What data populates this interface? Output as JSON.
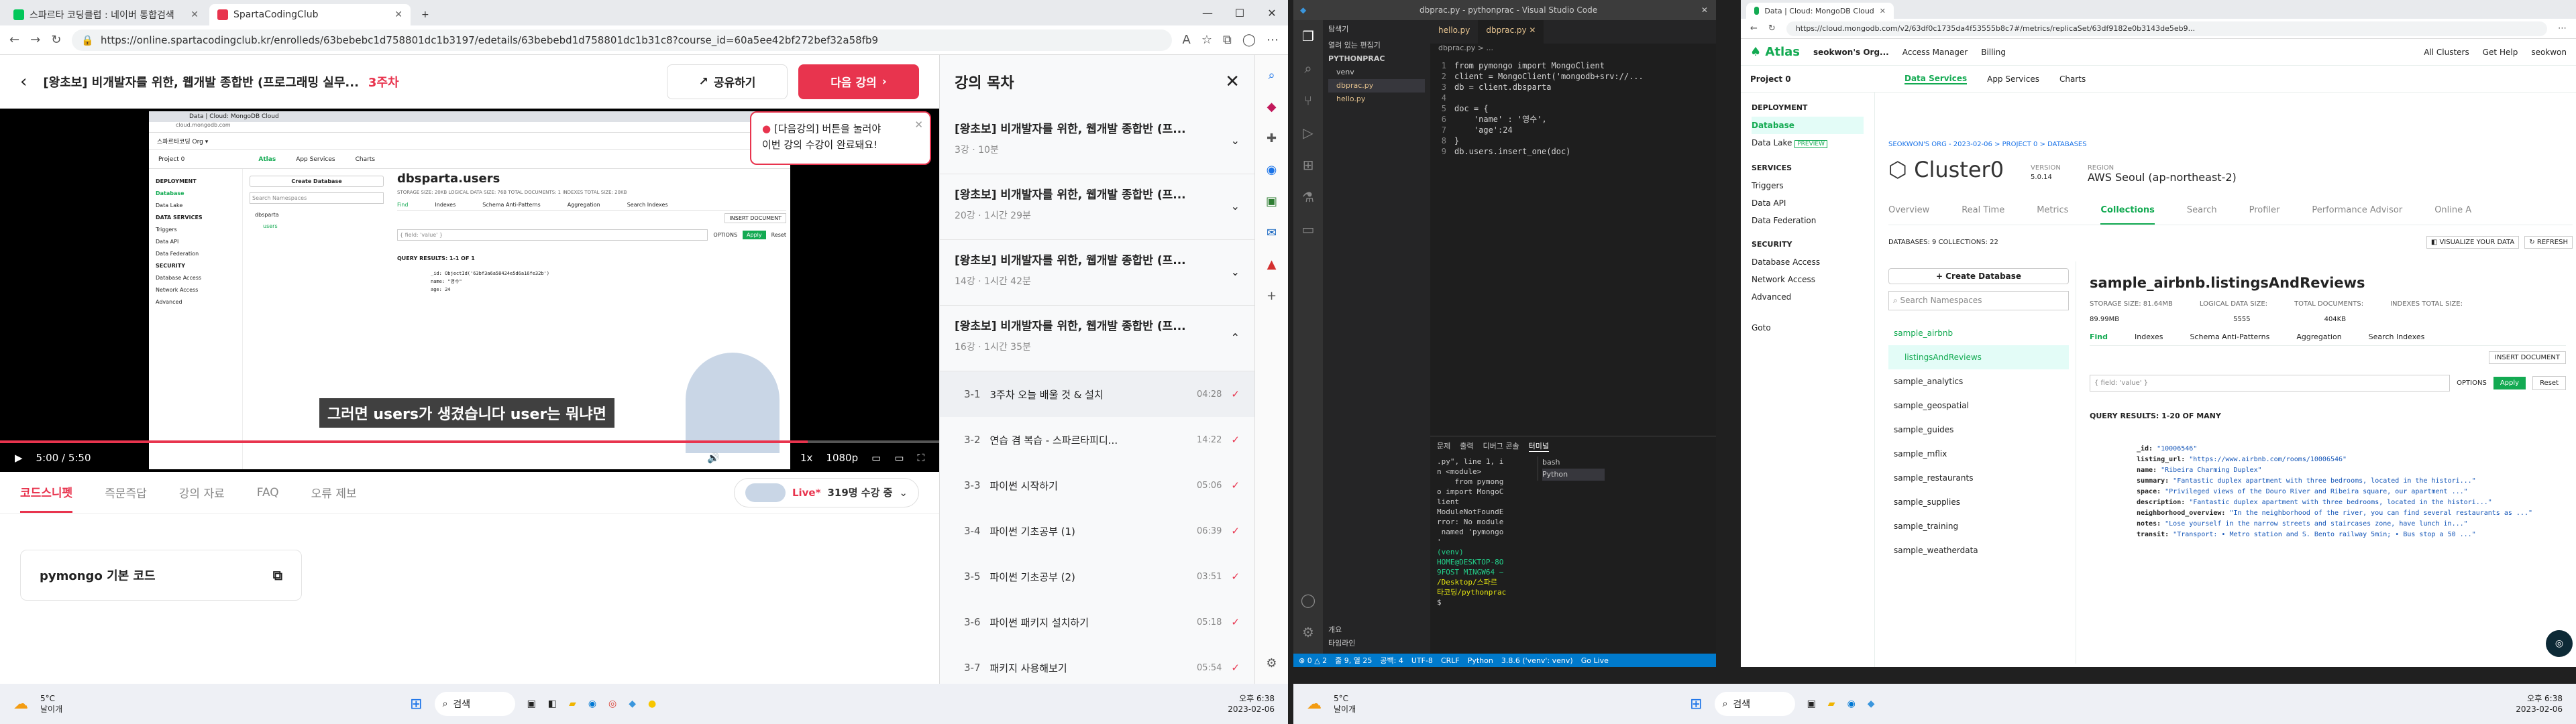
{
  "w1": {
    "tabs": [
      "스파르타 코딩클럽 : 네이버 통합검색",
      "SpartaCodingClub"
    ],
    "url": "https://online.spartacodingclub.kr/enrolleds/63bebebc1d758801dc1b3197/edetails/63bebebd1d758801dc1b31c8?course_id=60a5ee42bf272bef32a58fb9",
    "course_title": "[왕초보] 비개발자를 위한, 웹개발 종합반 (프로그래밍 실무...",
    "week": "3주차",
    "share": "공유하기",
    "next": "다음 강의",
    "tooltip1": "[다음강의] 버튼을 눌러야",
    "tooltip2": "이번 강의 수강이 완료돼요!",
    "subtitle": "그러면 users가 생겼습니다 user는 뭐냐면",
    "time": "5:00 / 5:50",
    "speed": "1x",
    "quality": "1080p",
    "tabs_below": [
      "코드스니펫",
      "즉문즉답",
      "강의 자료",
      "FAQ",
      "오류 제보"
    ],
    "live": "Live*",
    "live_count": "319명 수강 중",
    "snippet": "pymongo 기본 코드",
    "toc_title": "강의 목차",
    "weeks": [
      {
        "title": "[왕초보] 비개발자를 위한, 웹개발 종합반 (프...",
        "meta": "3강 · 10분"
      },
      {
        "title": "[왕초보] 비개발자를 위한, 웹개발 종합반 (프...",
        "meta": "20강 · 1시간 29분"
      },
      {
        "title": "[왕초보] 비개발자를 위한, 웹개발 종합반 (프...",
        "meta": "14강 · 1시간 42분"
      },
      {
        "title": "[왕초보] 비개발자를 위한, 웹개발 종합반 (프...",
        "meta": "16강 · 1시간 35분"
      }
    ],
    "lessons": [
      {
        "num": "3-1",
        "name": "3주차 오늘 배울 것 & 설치",
        "time": "04:28"
      },
      {
        "num": "3-2",
        "name": "연습 겸 복습 - 스파르타피디...",
        "time": "14:22"
      },
      {
        "num": "3-3",
        "name": "파이썬 시작하기",
        "time": "05:06"
      },
      {
        "num": "3-4",
        "name": "파이썬 기초공부 (1)",
        "time": "06:39"
      },
      {
        "num": "3-5",
        "name": "파이썬 기초공부 (2)",
        "time": "03:51"
      },
      {
        "num": "3-6",
        "name": "파이썬 패키지 설치하기",
        "time": "05:18"
      },
      {
        "num": "3-7",
        "name": "패키지 사용해보기",
        "time": "05:54"
      }
    ],
    "video": {
      "tab": "Data | Cloud: MongoDB Cloud",
      "crumbs": "스파르타코딩 Org ▾",
      "project": "Project 0",
      "coll": "dbsparta.users",
      "storage": "STORAGE SIZE: 20KB   LOGICAL DATA SIZE: 76B   TOTAL DOCUMENTS: 1   INDEXES TOTAL SIZE: 20KB",
      "ctabs": [
        "Find",
        "Indexes",
        "Schema Anti-Patterns",
        "Aggregation",
        "Search Indexes"
      ],
      "results": "QUERY RESULTS: 1-1 OF 1",
      "doc": [
        "_id: ObjectId('63bf3a6a58424e5d6a16fe32b')",
        "name: \"영수\"",
        "age: 24"
      ],
      "side": [
        "DEPLOYMENT",
        "Database",
        "Data Lake",
        "DATA SERVICES",
        "Triggers",
        "Data API",
        "Data Federation",
        "SECURITY",
        "Database Access",
        "Network Access",
        "Advanced"
      ],
      "nav": [
        "Atlas",
        "App Services",
        "Charts"
      ],
      "create": "Create Database",
      "search": "Search Namespaces",
      "db": "dbsparta",
      "col": "users",
      "insert": "INSERT DOCUMENT",
      "filter": "{ field: 'value' }",
      "opts": "OPTIONS",
      "apply": "Apply",
      "reset": "Reset"
    }
  },
  "w2": {
    "title": "dbprac.py - pythonprac - Visual Studio Code",
    "explorer": "탐색기",
    "open_editors": "열려 있는 편집기",
    "folder": "PYTHONPRAC",
    "files": [
      "venv",
      "dbprac.py",
      "hello.py"
    ],
    "tabs": [
      "hello.py",
      "dbprac.py"
    ],
    "crumb": "dbprac.py > ...",
    "code": [
      "from pymongo import MongoClient",
      "client = MongoClient('mongodb+srv://...",
      "db = client.dbsparta",
      "",
      "doc = {",
      "    'name' : '영수',",
      "    'age':24",
      "}",
      "db.users.insert_one(doc)"
    ],
    "panel_tabs": [
      "문제",
      "출력",
      "디버그 콘솔",
      "터미널"
    ],
    "terminal": [
      ".py\", line 1, i",
      "n <module>",
      "    from pymong",
      "o import MongoC",
      "lient",
      "ModuleNotFoundE",
      "rror: No module",
      " named 'pymongo",
      "'",
      "(venv)",
      "HOME@DESKTOP-8O",
      "9FOST MINGW64 ~",
      "/Desktop/스파르",
      "타코딩/pythonprac",
      "$"
    ],
    "shells": [
      "bash",
      "Python"
    ],
    "outline": [
      "개요",
      "타임라인"
    ],
    "status": [
      "⊗ 0 △ 2",
      "줄 9, 열 25",
      "공백: 4",
      "UTF-8",
      "CRLF",
      "Python",
      "3.8.6 ('venv': venv)",
      "Go Live"
    ]
  },
  "w3": {
    "tab": "Data | Cloud: MongoDB Cloud",
    "url": "https://cloud.mongodb.com/v2/63df0c1735da4f53555b8c7#/metrics/replicaSet/63df9182e0b3143de5eb9...",
    "org": "seokwon's Org...",
    "access": "Access Manager",
    "billing": "Billing",
    "clusters": "All Clusters",
    "help": "Get Help",
    "user": "seokwon",
    "project": "Project 0",
    "nav": [
      "Data Services",
      "App Services",
      "Charts"
    ],
    "side": {
      "deploy": "DEPLOYMENT",
      "database": "Database",
      "datalake": "Data Lake",
      "preview": "PREVIEW",
      "services": "SERVICES",
      "triggers": "Triggers",
      "dataapi": "Data API",
      "federation": "Data Federation",
      "security": "SECURITY",
      "dbaccess": "Database Access",
      "netaccess": "Network Access",
      "advanced": "Advanced",
      "goto": "Goto"
    },
    "crumbs": "SEOKWON'S ORG - 2023-02-06 > PROJECT 0 > DATABASES",
    "cluster": "Cluster0",
    "version_l": "VERSION",
    "version": "5.0.14",
    "region_l": "REGION",
    "region": "AWS Seoul (ap-northeast-2)",
    "ctabs": [
      "Overview",
      "Real Time",
      "Metrics",
      "Collections",
      "Search",
      "Profiler",
      "Performance Advisor",
      "Online A"
    ],
    "dbcount": "DATABASES: 9   COLLECTIONS: 22",
    "viz": "VISUALIZE YOUR DATA",
    "refresh": "REFRESH",
    "create": "Create Database",
    "search": "Search Namespaces",
    "dbs": [
      "sample_airbnb",
      "listingsAndReviews",
      "sample_analytics",
      "sample_geospatial",
      "sample_guides",
      "sample_mflix",
      "sample_restaurants",
      "sample_supplies",
      "sample_training",
      "sample_weatherdata"
    ],
    "coll": "sample_airbnb.listingsAndReviews",
    "stats_l": [
      "STORAGE SIZE: 81.64MB",
      "LOGICAL DATA SIZE:",
      "TOTAL DOCUMENTS:",
      "INDEXES TOTAL SIZE:"
    ],
    "stats": [
      "89.99MB",
      "5555",
      "404KB"
    ],
    "qtabs": [
      "Find",
      "Indexes",
      "Schema Anti-Patterns",
      "Aggregation",
      "Search Indexes"
    ],
    "insert": "INSERT DOCUMENT",
    "filter": "{ field: 'value' }",
    "opts": "OPTIONS",
    "apply": "Apply",
    "reset": "Reset",
    "results": "QUERY RESULTS: 1-20 OF MANY",
    "doc": [
      [
        "_id:",
        "\"10006546\""
      ],
      [
        "listing_url:",
        "\"https://www.airbnb.com/rooms/10006546\""
      ],
      [
        "name:",
        "\"Ribeira Charming Duplex\""
      ],
      [
        "summary:",
        "\"Fantastic duplex apartment with three bedrooms, located in the histori...\""
      ],
      [
        "space:",
        "\"Privileged views of the Douro River and Ribeira square, our apartment ...\""
      ],
      [
        "description:",
        "\"Fantastic duplex apartment with three bedrooms, located in the histori...\""
      ],
      [
        "neighborhood_overview:",
        "\"In the neighborhood of the river, you can find several restaurants as ...\""
      ],
      [
        "notes:",
        "\"Lose yourself in the narrow streets and staircases zone, have lunch in...\""
      ],
      [
        "transit:",
        "\"Transport: • Metro station and S. Bento railway 5min; • Bus stop a 50 ...\""
      ]
    ]
  },
  "taskbar": {
    "weather": "5°C",
    "weather_sub": "날이개",
    "search": "검색",
    "time": "오후 6:38",
    "date": "2023-02-06"
  },
  "taskbar2": {
    "weather": "5°C",
    "weather_sub": "날이개",
    "search": "검색",
    "time": "오후 6:38",
    "date": "2023-02-06"
  }
}
